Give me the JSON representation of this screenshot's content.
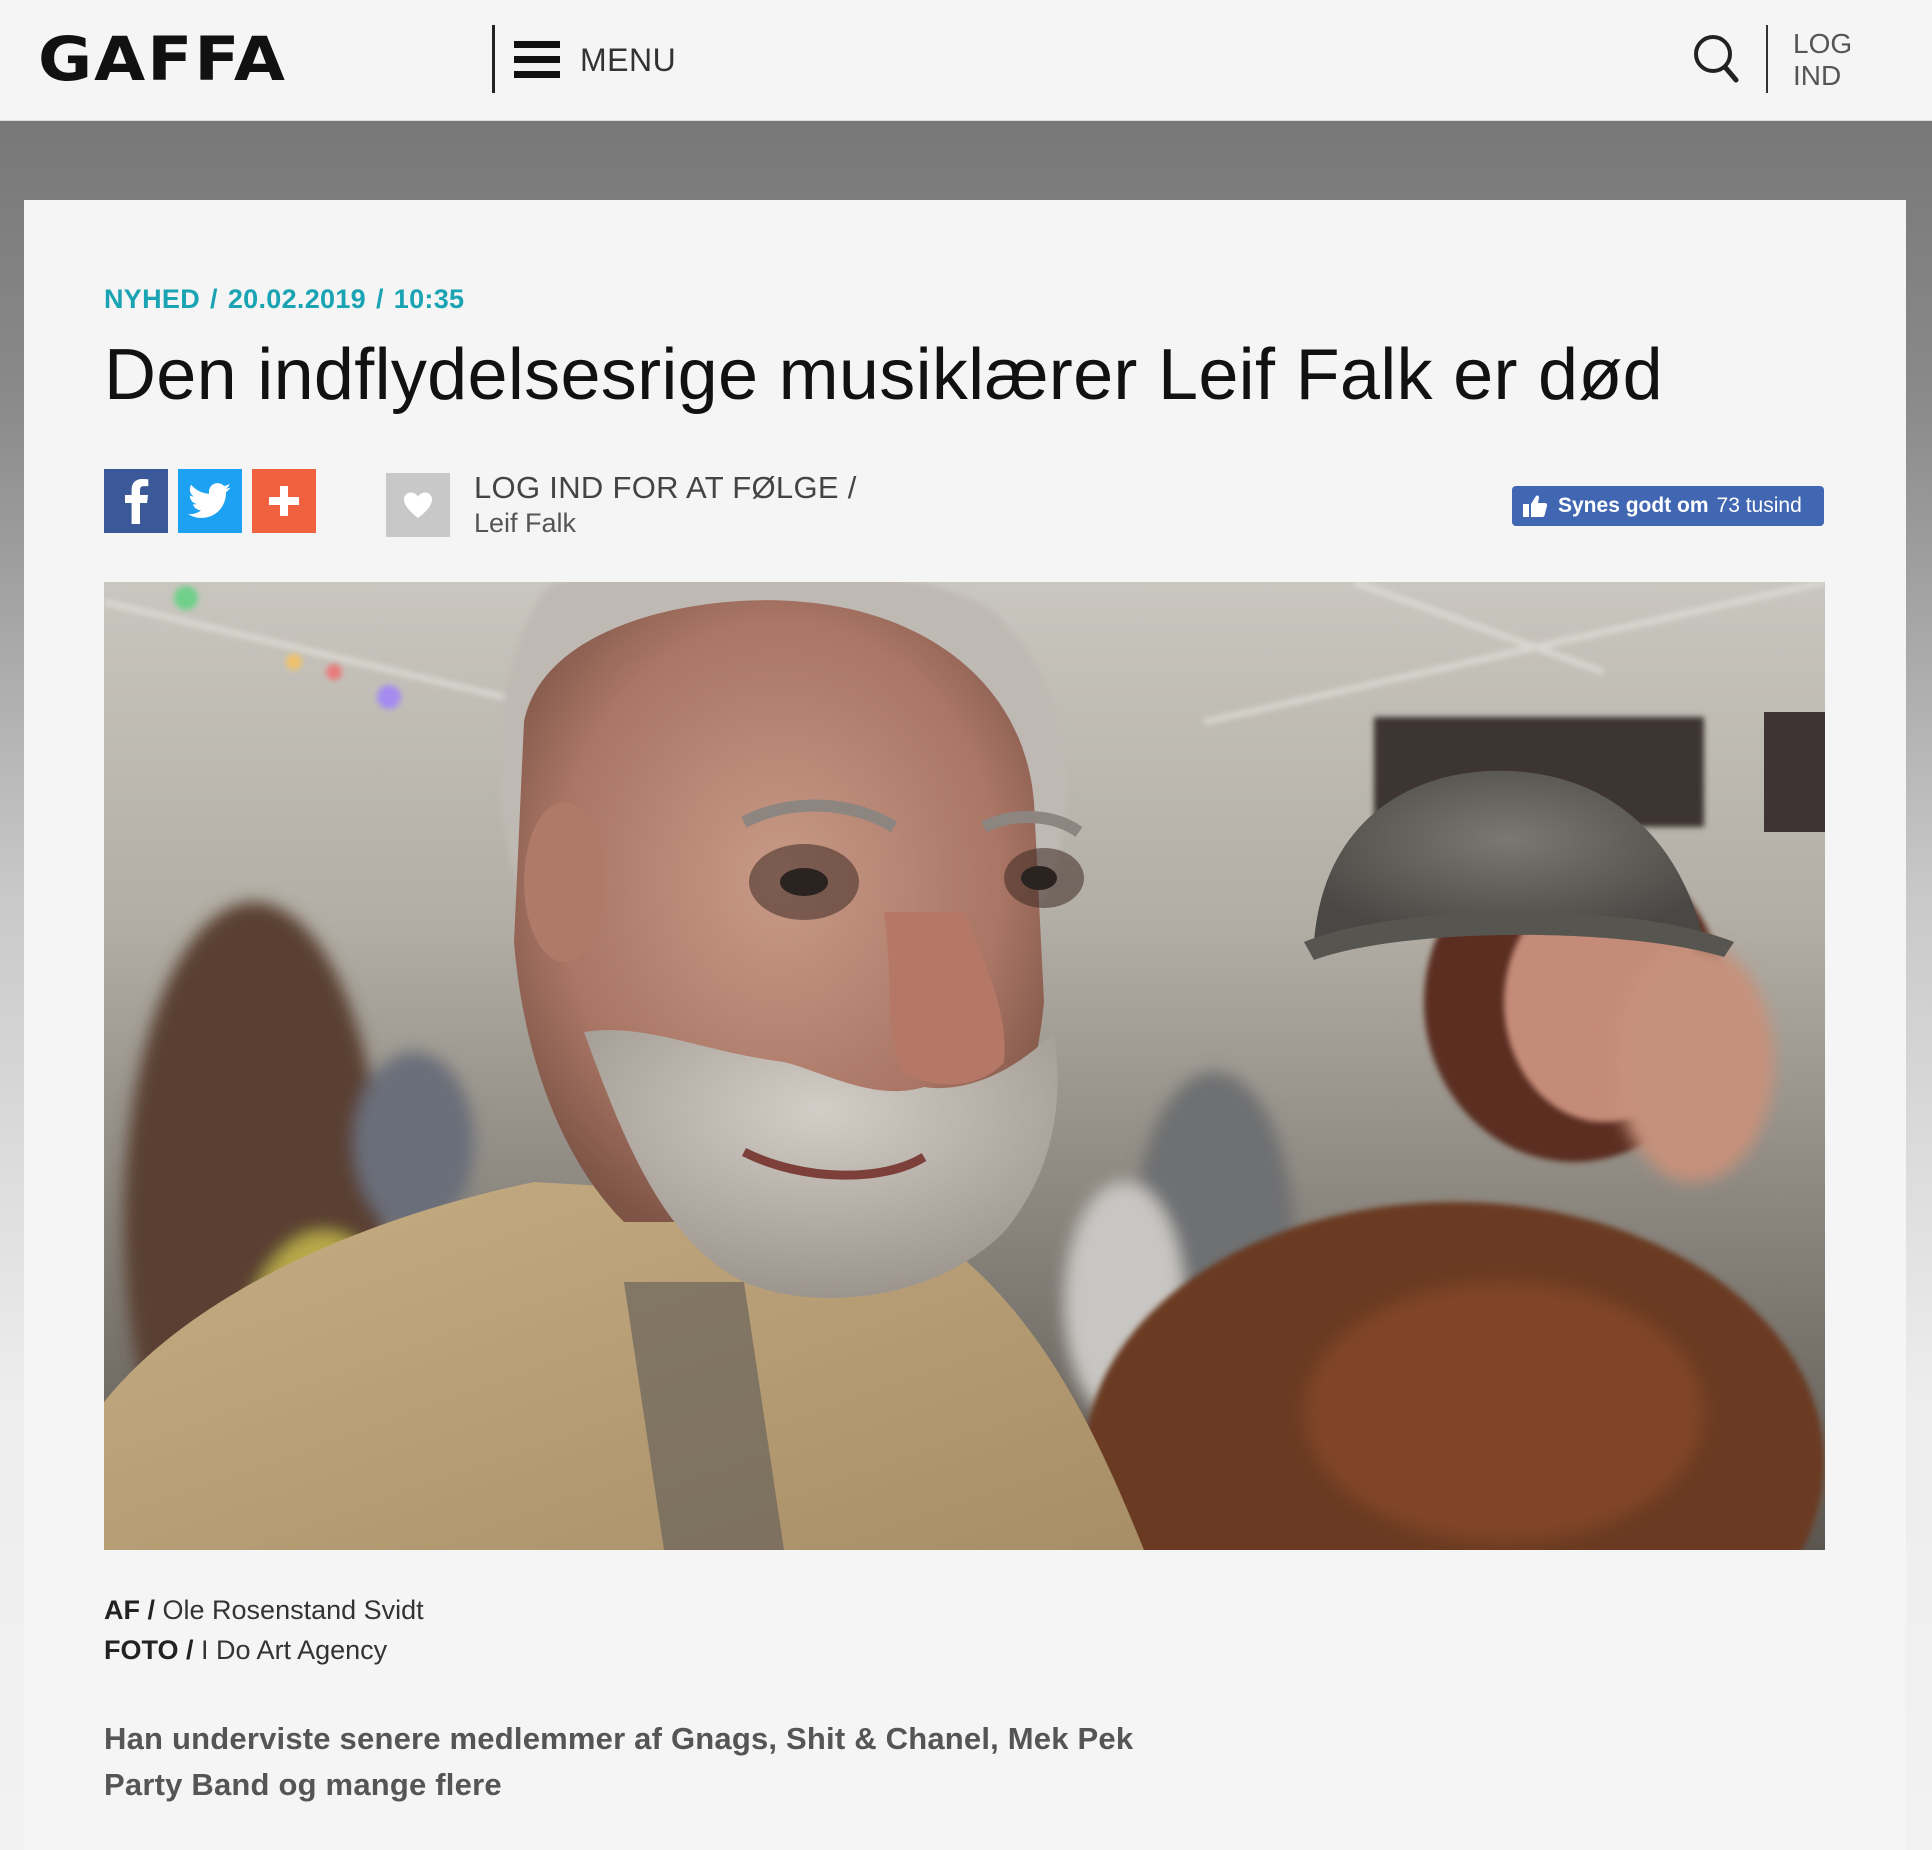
{
  "header": {
    "logo": "GAFFA",
    "menu_label": "MENU",
    "search_icon": "search-icon",
    "login_line1": "LOG",
    "login_line2": "IND"
  },
  "article": {
    "category": "NYHED",
    "date": "20.02.2019",
    "time": "10:35",
    "separator": "/",
    "title": "Den indflydelsesrige musiklærer Leif Falk er død",
    "share": {
      "icons": [
        "facebook-icon",
        "twitter-icon",
        "plus-icon"
      ]
    },
    "follow": {
      "label": "LOG IND FOR AT FØLGE /",
      "name": "Leif Falk",
      "icon": "heart-icon"
    },
    "like": {
      "label": "Synes godt om",
      "count": "73 tusind",
      "icon": "thumbs-up-icon"
    },
    "credits": {
      "author_label": "AF",
      "author": "Ole Rosenstand Svidt",
      "photo_label": "FOTO",
      "photographer": "I Do Art Agency"
    },
    "lead": "Han underviste senere medlemmer af Gnags, Shit & Chanel, Mek Pek Party Band og mange flere"
  },
  "colors": {
    "accent": "#1aa3b3",
    "facebook": "#3b5998",
    "twitter": "#1da1f2",
    "plus": "#f0623f",
    "like": "#4267b2"
  }
}
